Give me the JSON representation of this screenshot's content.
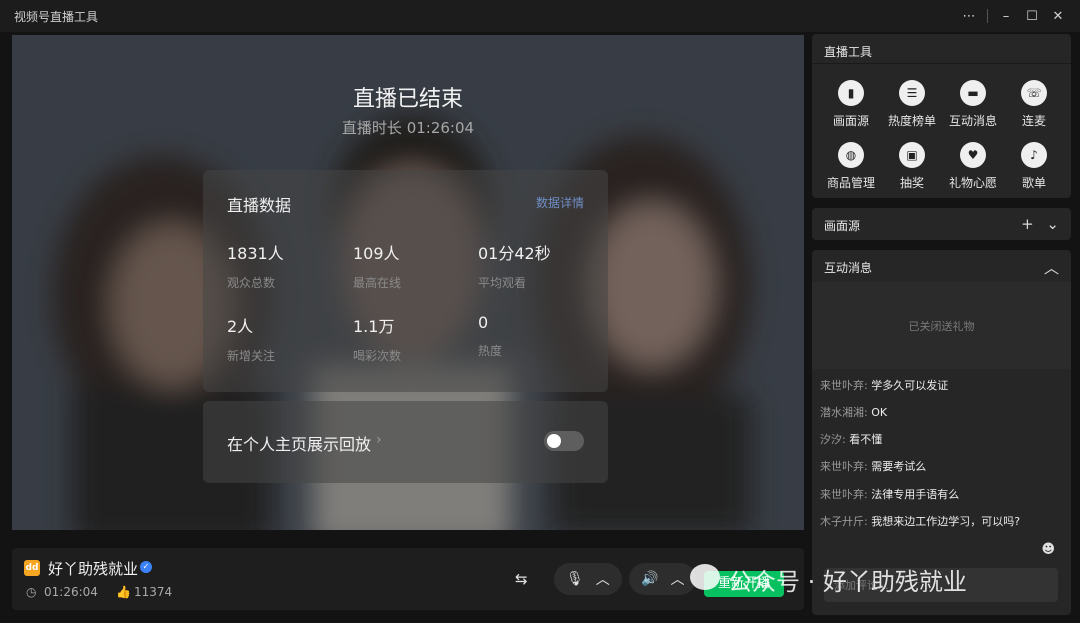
{
  "window": {
    "title": "视频号直播工具"
  },
  "live_end": {
    "title": "直播已结束",
    "duration": "直播时长 01:26:04"
  },
  "stats": {
    "title": "直播数据",
    "detail_link": "数据详情",
    "items": [
      {
        "value": "1831人",
        "label": "观众总数"
      },
      {
        "value": "109人",
        "label": "最高在线"
      },
      {
        "value": "01分42秒",
        "label": "平均观看"
      },
      {
        "value": "2人",
        "label": "新增关注"
      },
      {
        "value": "1.1万",
        "label": "喝彩次数"
      },
      {
        "value": "0",
        "label": "热度"
      }
    ]
  },
  "replay": {
    "label": "在个人主页展示回放",
    "toggle_on": false
  },
  "anchor": {
    "name": "好丫助残就业",
    "duration": "01:26:04",
    "likes": "11374"
  },
  "bottom_controls": {
    "restart_label": "重新开播"
  },
  "tools_panel": {
    "title": "直播工具",
    "items": [
      {
        "label": "画面源",
        "icon": "screen-source-icon"
      },
      {
        "label": "热度榜单",
        "icon": "list-icon"
      },
      {
        "label": "互动消息",
        "icon": "chat-icon"
      },
      {
        "label": "连麦",
        "icon": "phone-icon"
      },
      {
        "label": "商品管理",
        "icon": "bag-icon"
      },
      {
        "label": "抽奖",
        "icon": "gift-box-icon"
      },
      {
        "label": "礼物心愿",
        "icon": "heart-icon"
      },
      {
        "label": "歌单",
        "icon": "music-icon"
      }
    ]
  },
  "source_panel": {
    "title": "画面源"
  },
  "interact_panel": {
    "title": "互动消息",
    "empty_note": "已关闭送礼物",
    "messages": [
      {
        "user": "来世卟弃:",
        "text": "学多久可以发证"
      },
      {
        "user": "潜水湘湘:",
        "text": "OK"
      },
      {
        "user": "汐汐:",
        "text": "看不懂"
      },
      {
        "user": "来世卟弃:",
        "text": "需要考试么"
      },
      {
        "user": "来世卟弃:",
        "text": "法律专用手语有么"
      },
      {
        "user": "木子廾斤:",
        "text": "我想来边工作边学习，可以吗?"
      }
    ],
    "input_placeholder": "添加评论..."
  },
  "watermark": "公众号 · 好丫助残就业"
}
